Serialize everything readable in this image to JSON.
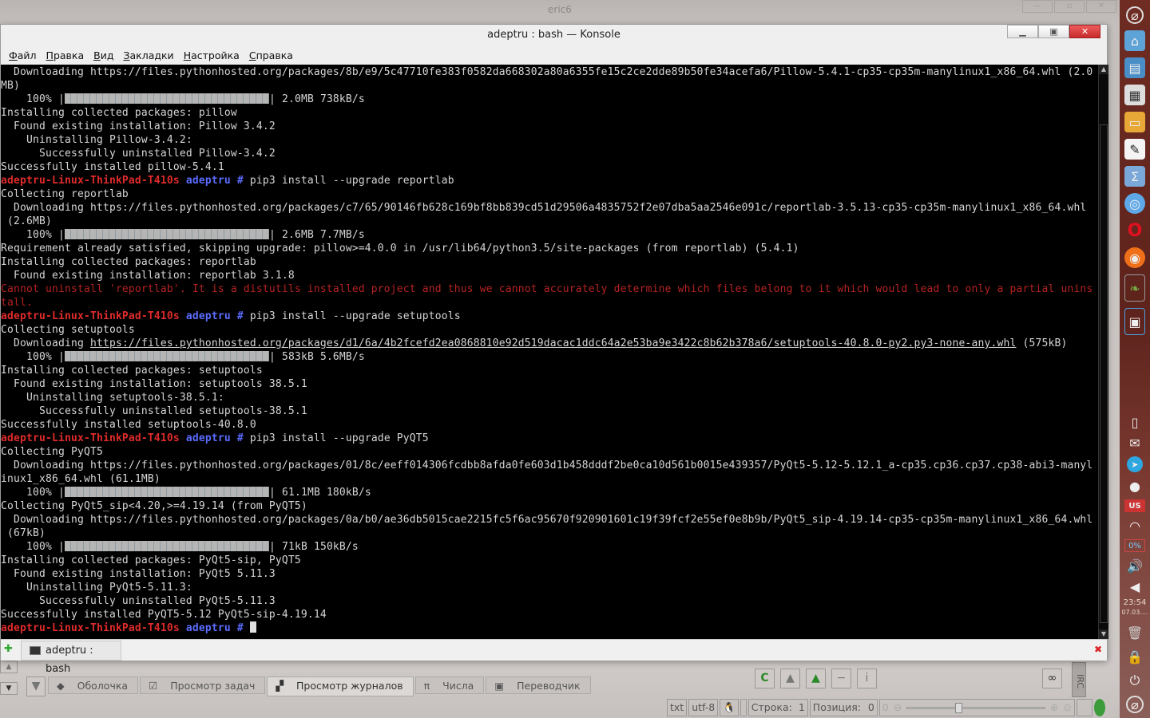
{
  "background_window": {
    "title": "eric6",
    "bottom_tabs": [
      {
        "label": "Оболочка",
        "icon": "shell-icon"
      },
      {
        "label": "Просмотр задач",
        "icon": "tasks-icon"
      },
      {
        "label": "Просмотр журналов",
        "icon": "log-icon",
        "active": true
      },
      {
        "label": "Числа",
        "icon": "pi-icon"
      },
      {
        "label": "Переводчик",
        "icon": "translator-icon"
      }
    ],
    "side_label": "IRC",
    "status": {
      "filetype": "txt",
      "encoding": "utf-8",
      "line_label": "Строка:",
      "line_value": "1",
      "pos_label": "Позиция:",
      "pos_value": "0",
      "zoom_value": "0"
    }
  },
  "konsole": {
    "title": "adeptru : bash — Konsole",
    "menu": [
      "Файл",
      "Правка",
      "Вид",
      "Закладки",
      "Настройка",
      "Справка"
    ],
    "tab_label": "adeptru : bash",
    "lines": [
      [
        [
          "",
          "  Downloading https://files.pythonhosted.org/packages/8b/e9/5c47710fe383f0582da668302a80a6355fe15c2ce2dde89b50fe34acefa6/Pillow-5.4.1-cp35-cp35m-manylinux1_x86_64.whl (2.0"
        ]
      ],
      [
        [
          "",
          "MB)"
        ]
      ],
      [
        [
          "",
          "    100% |"
        ],
        [
          "bar",
          "100"
        ],
        [
          "",
          "| 2.0MB 738kB/s"
        ]
      ],
      [
        [
          "",
          "Installing collected packages: pillow"
        ]
      ],
      [
        [
          "",
          "  Found existing installation: Pillow 3.4.2"
        ]
      ],
      [
        [
          "",
          "    Uninstalling Pillow-3.4.2:"
        ]
      ],
      [
        [
          "",
          "      Successfully uninstalled Pillow-3.4.2"
        ]
      ],
      [
        [
          "",
          "Successfully installed pillow-5.4.1"
        ]
      ],
      [
        [
          "host",
          "adeptru-Linux-ThinkPad-T410s"
        ],
        [
          "usr",
          " adeptru #"
        ],
        [
          "",
          " pip3 install --upgrade reportlab"
        ]
      ],
      [
        [
          "",
          "Collecting reportlab"
        ]
      ],
      [
        [
          "",
          "  Downloading https://files.pythonhosted.org/packages/c7/65/90146fb628c169bf8bb839cd51d29506a4835752f2e07dba5aa2546e091c/reportlab-3.5.13-cp35-cp35m-manylinux1_x86_64.whl"
        ]
      ],
      [
        [
          "",
          " (2.6MB)"
        ]
      ],
      [
        [
          "",
          "    100% |"
        ],
        [
          "bar",
          "100"
        ],
        [
          "",
          "| 2.6MB 7.7MB/s"
        ]
      ],
      [
        [
          "",
          "Requirement already satisfied, skipping upgrade: pillow>=4.0.0 in /usr/lib64/python3.5/site-packages (from reportlab) (5.4.1)"
        ]
      ],
      [
        [
          "",
          "Installing collected packages: reportlab"
        ]
      ],
      [
        [
          "",
          "  Found existing installation: reportlab 3.1.8"
        ]
      ],
      [
        [
          "err",
          "Cannot uninstall 'reportlab'. It is a distutils installed project and thus we cannot accurately determine which files belong to it which would lead to only a partial unins"
        ]
      ],
      [
        [
          "err",
          "tall."
        ]
      ],
      [
        [
          "host",
          "adeptru-Linux-ThinkPad-T410s"
        ],
        [
          "usr",
          " adeptru #"
        ],
        [
          "",
          " pip3 install --upgrade setuptools"
        ]
      ],
      [
        [
          "",
          "Collecting setuptools"
        ]
      ],
      [
        [
          "",
          "  Downloading "
        ],
        [
          "url",
          "https://files.pythonhosted.org/packages/d1/6a/4b2fcefd2ea0868810e92d519dacac1ddc64a2e53ba9e3422c8b62b378a6/setuptools-40.8.0-py2.py3-none-any.whl"
        ],
        [
          "",
          " (575kB)"
        ]
      ],
      [
        [
          "",
          "    100% |"
        ],
        [
          "bar",
          "100"
        ],
        [
          "",
          "| 583kB 5.6MB/s"
        ]
      ],
      [
        [
          "",
          "Installing collected packages: setuptools"
        ]
      ],
      [
        [
          "",
          "  Found existing installation: setuptools 38.5.1"
        ]
      ],
      [
        [
          "",
          "    Uninstalling setuptools-38.5.1:"
        ]
      ],
      [
        [
          "",
          "      Successfully uninstalled setuptools-38.5.1"
        ]
      ],
      [
        [
          "",
          "Successfully installed setuptools-40.8.0"
        ]
      ],
      [
        [
          "host",
          "adeptru-Linux-ThinkPad-T410s"
        ],
        [
          "usr",
          " adeptru #"
        ],
        [
          "",
          " pip3 install --upgrade PyQT5"
        ]
      ],
      [
        [
          "",
          "Collecting PyQT5"
        ]
      ],
      [
        [
          "",
          "  Downloading https://files.pythonhosted.org/packages/01/8c/eeff014306fcdbb8afda0fe603d1b458dddf2be0ca10d561b0015e439357/PyQt5-5.12-5.12.1_a-cp35.cp36.cp37.cp38-abi3-manyl"
        ]
      ],
      [
        [
          "",
          "inux1_x86_64.whl (61.1MB)"
        ]
      ],
      [
        [
          "",
          "    100% |"
        ],
        [
          "bar",
          "100"
        ],
        [
          "",
          "| 61.1MB 180kB/s"
        ]
      ],
      [
        [
          "",
          "Collecting PyQt5_sip<4.20,>=4.19.14 (from PyQT5)"
        ]
      ],
      [
        [
          "",
          "  Downloading https://files.pythonhosted.org/packages/0a/b0/ae36db5015cae2215fc5f6ac95670f920901601c19f39fcf2e55ef0e8b9b/PyQt5_sip-4.19.14-cp35-cp35m-manylinux1_x86_64.whl"
        ]
      ],
      [
        [
          "",
          " (67kB)"
        ]
      ],
      [
        [
          "",
          "    100% |"
        ],
        [
          "bar",
          "100"
        ],
        [
          "",
          "| 71kB 150kB/s"
        ]
      ],
      [
        [
          "",
          "Installing collected packages: PyQt5-sip, PyQT5"
        ]
      ],
      [
        [
          "",
          "  Found existing installation: PyQt5 5.11.3"
        ]
      ],
      [
        [
          "",
          "    Uninstalling PyQt5-5.11.3:"
        ]
      ],
      [
        [
          "",
          "      Successfully uninstalled PyQt5-5.11.3"
        ]
      ],
      [
        [
          "",
          "Successfully installed PyQT5-5.12 PyQt5-sip-4.19.14"
        ]
      ],
      [
        [
          "host",
          "adeptru-Linux-ThinkPad-T410s"
        ],
        [
          "usr",
          " adeptru #"
        ],
        [
          "",
          " "
        ],
        [
          "cursor",
          ""
        ]
      ]
    ]
  },
  "panel": {
    "time": "23:54",
    "date": "07.03....",
    "battery": "0%",
    "keyboard_layout": "US"
  },
  "colors": {
    "host": "#e02b2b",
    "user": "#5b6cff",
    "error": "#b52222",
    "panel": "#6e2c23"
  }
}
